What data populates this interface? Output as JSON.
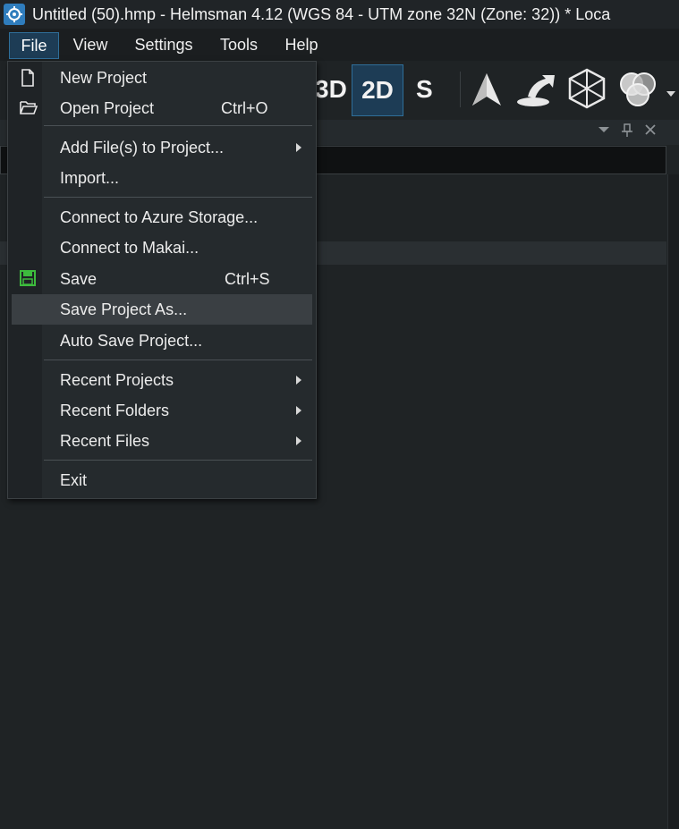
{
  "window": {
    "title": "Untitled (50).hmp - Helmsman 4.12 (WGS 84 - UTM zone 32N (Zone: 32)) * Loca"
  },
  "menubar": {
    "items": [
      "File",
      "View",
      "Settings",
      "Tools",
      "Help"
    ]
  },
  "toolbar": {
    "btn_3d": "3D",
    "btn_2d": "2D",
    "btn_s": "S",
    "icons": [
      "north-arrow-icon",
      "sun-light-icon",
      "wireframe-cube-icon",
      "color-blend-icon",
      "dropdown-arrow-icon"
    ]
  },
  "file_menu": {
    "new_project": "New Project",
    "open_project": "Open Project",
    "open_project_shortcut": "Ctrl+O",
    "add_files": "Add File(s) to Project...",
    "import": "Import...",
    "connect_azure": "Connect to Azure Storage...",
    "connect_makai": "Connect to Makai...",
    "save": "Save",
    "save_shortcut": "Ctrl+S",
    "save_project_as": "Save Project As...",
    "auto_save": "Auto Save Project...",
    "recent_projects": "Recent Projects",
    "recent_folders": "Recent Folders",
    "recent_files": "Recent Files",
    "exit": "Exit"
  },
  "colors": {
    "accent": "#2f6e99",
    "active_bg": "#1d3c55",
    "hover_bg": "#3a3f43",
    "save_icon": "#3dbb3d"
  }
}
